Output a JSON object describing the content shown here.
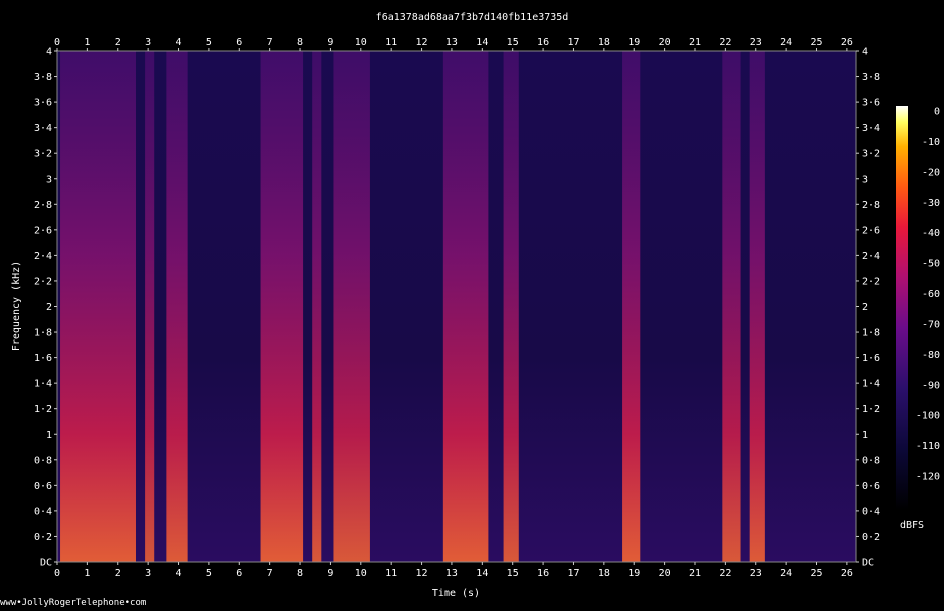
{
  "chart_data": {
    "type": "heatmap",
    "title": "f6a1378ad68aa7f3b7d140fb11e3735d",
    "xlabel": "Time (s)",
    "ylabel": "Frequency (kHz)",
    "xlim": [
      0,
      26.3
    ],
    "ylim": [
      0,
      4
    ],
    "x_ticks": [
      "0",
      "1",
      "2",
      "3",
      "4",
      "5",
      "6",
      "7",
      "8",
      "9",
      "10",
      "11",
      "12",
      "13",
      "14",
      "15",
      "16",
      "17",
      "18",
      "19",
      "20",
      "21",
      "22",
      "23",
      "24",
      "25",
      "26"
    ],
    "y_ticks": [
      "DC",
      "0·2",
      "0·4",
      "0·6",
      "0·8",
      "1",
      "1·2",
      "1·4",
      "1·6",
      "1·8",
      "2",
      "2·2",
      "2·4",
      "2·6",
      "2·8",
      "3",
      "3·2",
      "3·4",
      "3·6",
      "3·8",
      "4"
    ],
    "colorbar": {
      "unit": "dBFS",
      "ticks": [
        "0",
        "-10",
        "-20",
        "-30",
        "-40",
        "-50",
        "-60",
        "-70",
        "-80",
        "-90",
        "-100",
        "-110",
        "-120"
      ],
      "range": [
        -120,
        0
      ]
    },
    "active_segments": [
      {
        "start": 0.1,
        "end": 2.6,
        "level_db": -45
      },
      {
        "start": 2.9,
        "end": 3.2,
        "level_db": -60
      },
      {
        "start": 3.6,
        "end": 4.3,
        "level_db": -50
      },
      {
        "start": 6.7,
        "end": 8.1,
        "level_db": -45
      },
      {
        "start": 8.4,
        "end": 8.7,
        "level_db": -55
      },
      {
        "start": 9.1,
        "end": 10.3,
        "level_db": -55
      },
      {
        "start": 12.7,
        "end": 14.2,
        "level_db": -45
      },
      {
        "start": 14.7,
        "end": 15.2,
        "level_db": -55
      },
      {
        "start": 18.6,
        "end": 19.2,
        "level_db": -45
      },
      {
        "start": 21.9,
        "end": 22.5,
        "level_db": -55
      },
      {
        "start": 22.8,
        "end": 23.3,
        "level_db": -50
      }
    ]
  },
  "footer": "www•JollyRogerTelephone•com"
}
